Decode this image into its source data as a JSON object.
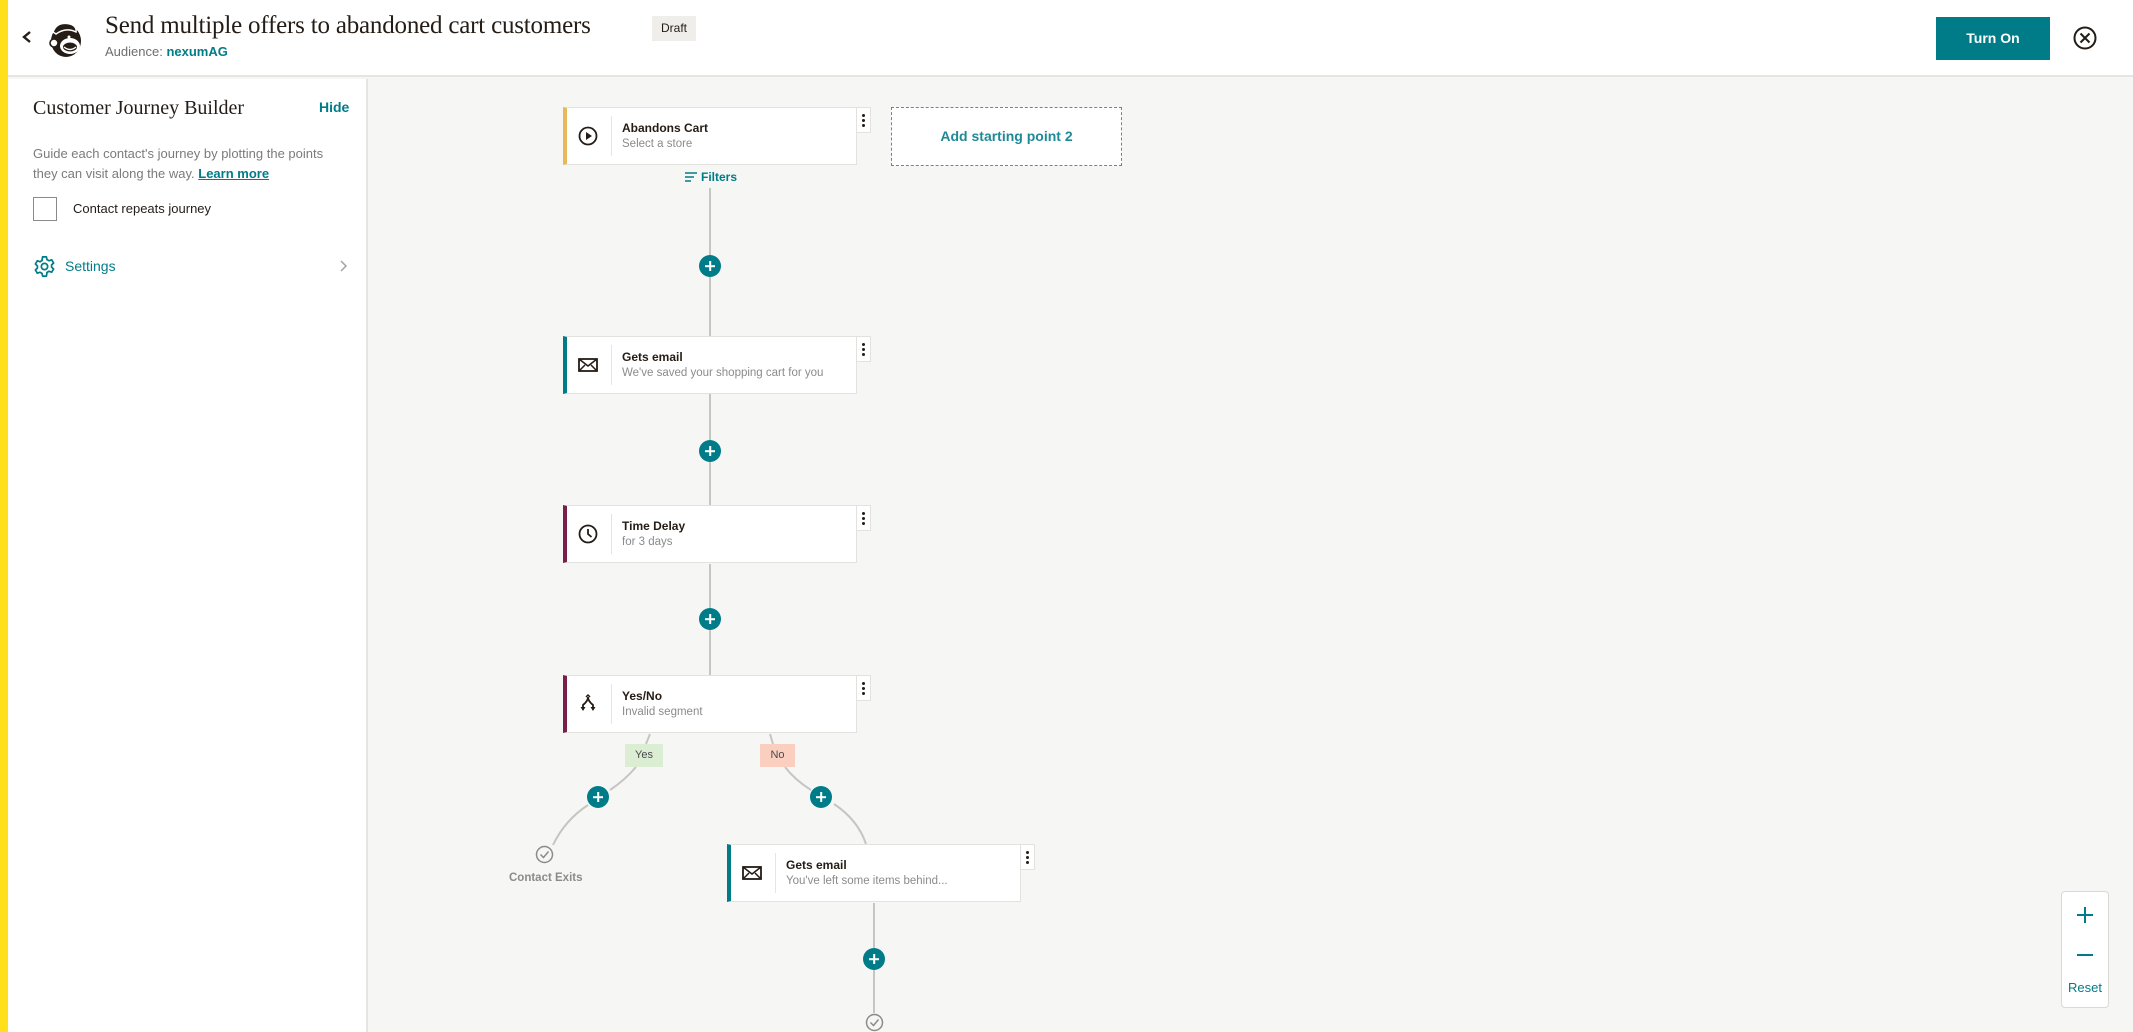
{
  "header": {
    "title": "Send multiple offers to abandoned cart customers",
    "status_badge": "Draft",
    "audience_label": "Audience:",
    "audience_name": "nexumAG",
    "turn_on_label": "Turn On"
  },
  "sidebar": {
    "title": "Customer Journey Builder",
    "hide_label": "Hide",
    "description": "Guide each contact's journey by plotting the points they can visit along the way.",
    "learn_more_label": "Learn more",
    "repeat_checkbox_label": "Contact repeats journey",
    "repeat_checked": false,
    "settings_label": "Settings"
  },
  "journey": {
    "trigger": {
      "title": "Abandons Cart",
      "subtitle": "Select a store",
      "icon": "play-circle-icon",
      "accent": "#e8b85b"
    },
    "filters_label": "Filters",
    "add_starting_point_label": "Add starting point 2",
    "steps": [
      {
        "title": "Gets email",
        "subtitle": "We've saved your shopping cart for you",
        "icon": "envelope-icon",
        "accent": "#007c89"
      },
      {
        "title": "Time Delay",
        "subtitle": "for 3 days",
        "icon": "clock-icon",
        "accent": "#7a2048"
      },
      {
        "title": "Yes/No",
        "subtitle": "Invalid segment",
        "icon": "branch-icon",
        "accent": "#7a2048"
      }
    ],
    "branches": {
      "yes_label": "Yes",
      "no_label": "No",
      "yes_exit_label": "Contact Exits",
      "no_step": {
        "title": "Gets email",
        "subtitle": "You've left some items behind...",
        "icon": "envelope-icon",
        "accent": "#007c89"
      }
    }
  },
  "zoom_controls": {
    "zoom_in": "+",
    "zoom_out": "−",
    "reset_label": "Reset"
  },
  "colors": {
    "brand_yellow": "#ffe01b",
    "teal": "#007c89",
    "canvas_bg": "#f6f6f4",
    "yes_bg": "#dbedd3",
    "no_bg": "#fbcfc0"
  }
}
